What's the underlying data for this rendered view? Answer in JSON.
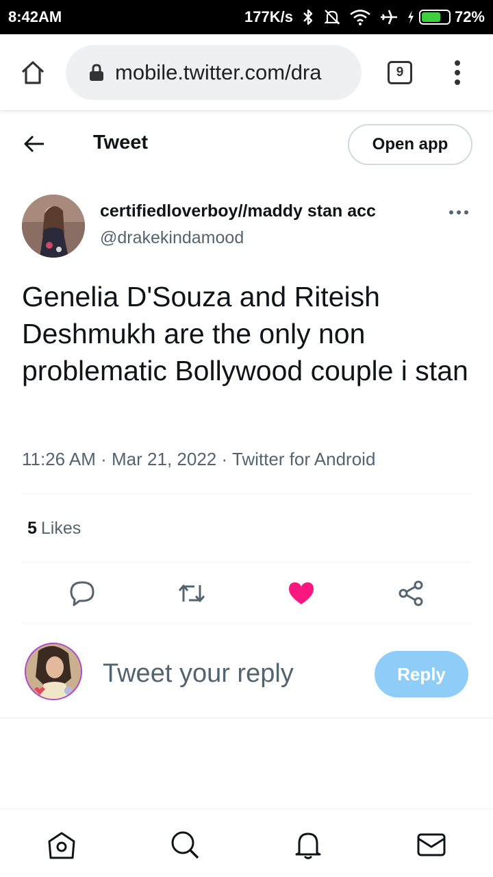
{
  "status_bar": {
    "time": "8:42AM",
    "network_speed": "177K/s",
    "battery_percent": "72%",
    "battery_level": 0.72,
    "icons": [
      "bluetooth-icon",
      "mute-bell-icon",
      "wifi-icon",
      "airplane-icon",
      "charging-bolt-icon",
      "battery-icon"
    ]
  },
  "browser": {
    "url": "mobile.twitter.com/dra",
    "tab_count": "9",
    "icons": [
      "home-icon",
      "lock-icon",
      "tabs-icon",
      "overflow-menu-icon"
    ]
  },
  "header": {
    "title": "Tweet",
    "open_app_label": "Open app"
  },
  "tweet": {
    "author_name": "certifiedloverboy//maddy stan acc",
    "author_handle": "@drakekindamood",
    "text": "Genelia D'Souza and Riteish Deshmukh are the only non problematic Bollywood couple i stan",
    "meta": "11:26 AM · Mar 21, 2022 · Twitter for Android",
    "likes_count": "5",
    "likes_label": "Likes",
    "liked": true
  },
  "actions": [
    "reply-icon",
    "retweet-icon",
    "like-icon",
    "share-icon"
  ],
  "composer": {
    "placeholder": "Tweet your reply",
    "reply_label": "Reply"
  },
  "bottom_nav": [
    "home-icon",
    "search-icon",
    "notifications-icon",
    "messages-icon"
  ],
  "colors": {
    "like": "#f91880",
    "reply_button": "#8ecdf7",
    "secondary_text": "#536471"
  }
}
